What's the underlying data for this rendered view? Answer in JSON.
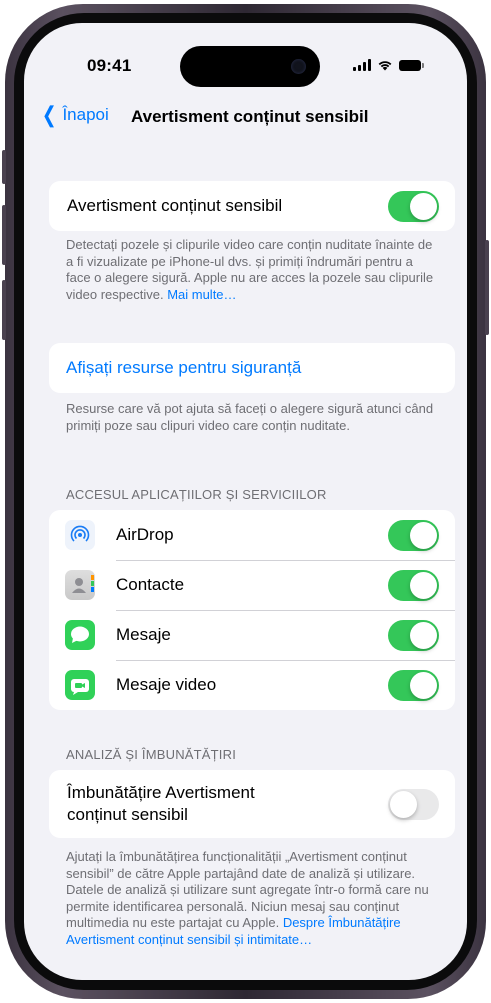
{
  "status_bar": {
    "time": "09:41"
  },
  "nav": {
    "back_label": "Înapoi",
    "title": "Avertisment conținut sensibil"
  },
  "main_toggle": {
    "label": "Avertisment conținut sensibil",
    "on": true,
    "on_color": "#34c759"
  },
  "main_footer": {
    "text": "Detectați pozele și clipurile video care conțin nuditate înainte de a fi vizualizate pe iPhone-ul dvs. și primiți îndrumări pentru a face o alegere sigură. Apple nu are acces la pozele sau clipurile video respective.",
    "link": "Mai multe…"
  },
  "resources": {
    "label": "Afișați resurse pentru siguranță"
  },
  "resources_footer": {
    "text": "Resurse care vă pot ajuta să faceți o alegere sigură atunci când primiți poze sau clipuri video care conțin nuditate."
  },
  "apps_section": {
    "header": "ACCESUL APLICAȚIILOR ȘI SERVICIILOR",
    "items": [
      {
        "label": "AirDrop",
        "icon": "airdrop-icon",
        "on": true
      },
      {
        "label": "Contacte",
        "icon": "contacts-icon",
        "on": true
      },
      {
        "label": "Mesaje",
        "icon": "messages-icon",
        "on": true
      },
      {
        "label": "Mesaje video",
        "icon": "facetime-icon",
        "on": true
      }
    ]
  },
  "analysis_section": {
    "header": "ANALIZĂ ȘI ÎMBUNĂTĂȚIRI",
    "label_line1": "Îmbunătățire Avertisment",
    "label_line2": "conținut sensibil",
    "on": false,
    "footer_text": "Ajutați la îmbunătățirea funcționalității „Avertisment conținut sensibil” de către Apple partajând date de analiză și utilizare. Datele de analiză și utilizare sunt agregate într-o formă care nu permite identificarea personală. Niciun mesaj sau conținut multimedia nu este partajat cu Apple.",
    "footer_link": "Despre Îmbunătățire Avertisment conținut sensibil și intimitate…"
  },
  "colors": {
    "accent": "#007aff",
    "toggle_on": "#34c759",
    "background": "#f2f2f7"
  }
}
